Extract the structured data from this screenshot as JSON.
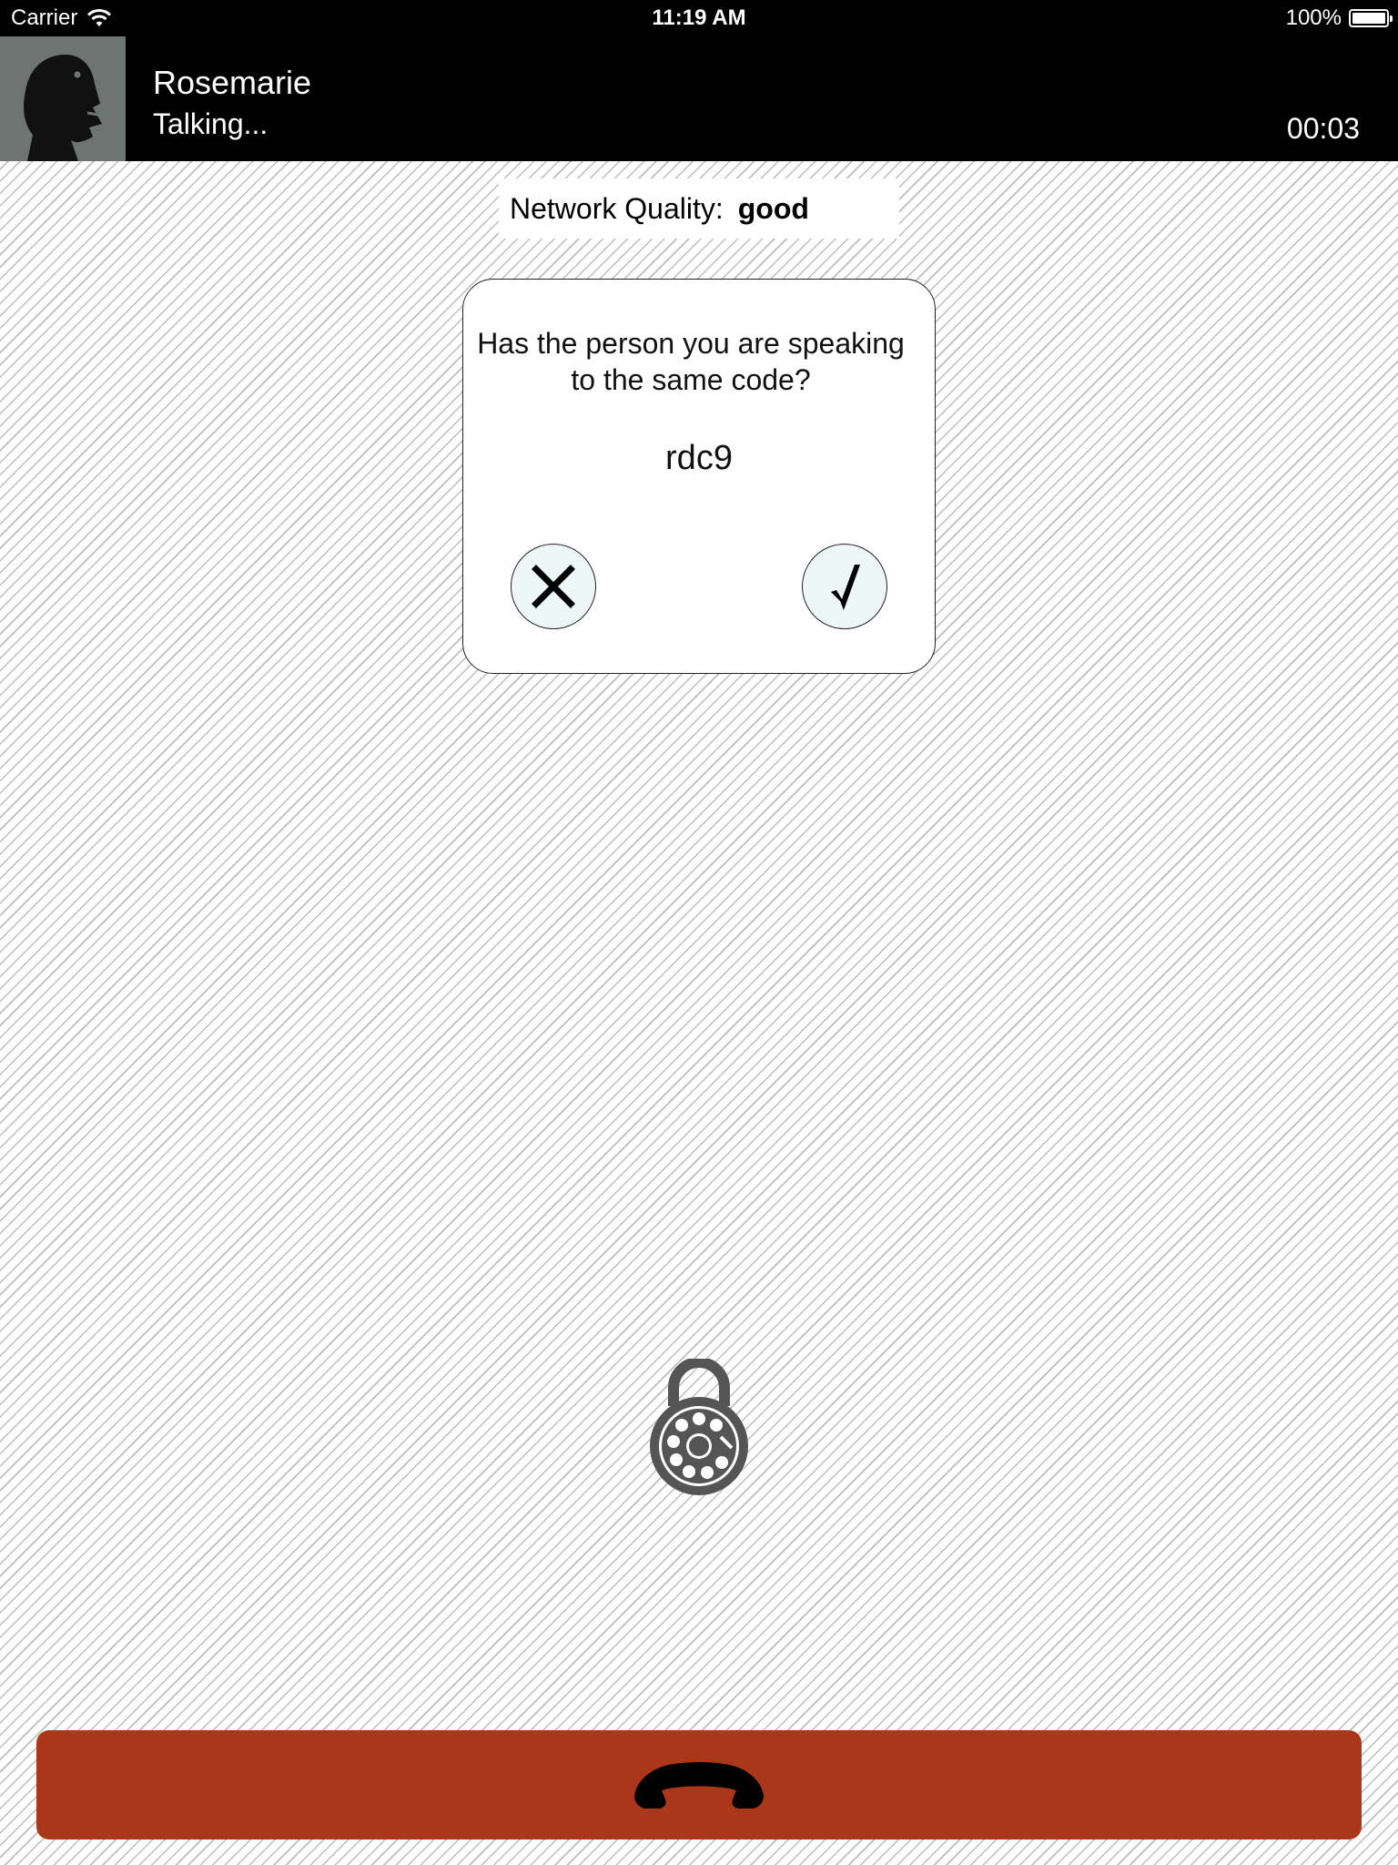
{
  "status_bar": {
    "carrier": "Carrier",
    "time": "11:19 AM",
    "battery": "100%",
    "icons": [
      "wifi-icon",
      "battery-icon"
    ]
  },
  "call": {
    "caller_name": "Rosemarie",
    "status": "Talking...",
    "duration": "00:03",
    "avatar_icon": "silhouette-head-icon"
  },
  "network": {
    "label": "Network Quality:",
    "value": "good"
  },
  "verification": {
    "question": "Has the person you are speaking to the same code?",
    "code": "rdc9",
    "reject_icon": "close-icon",
    "confirm_icon": "checkmark-icon"
  },
  "security": {
    "icon": "rotary-dial-lock-icon"
  },
  "hangup": {
    "icon": "phone-hangup-icon",
    "color": "#aa3719"
  }
}
